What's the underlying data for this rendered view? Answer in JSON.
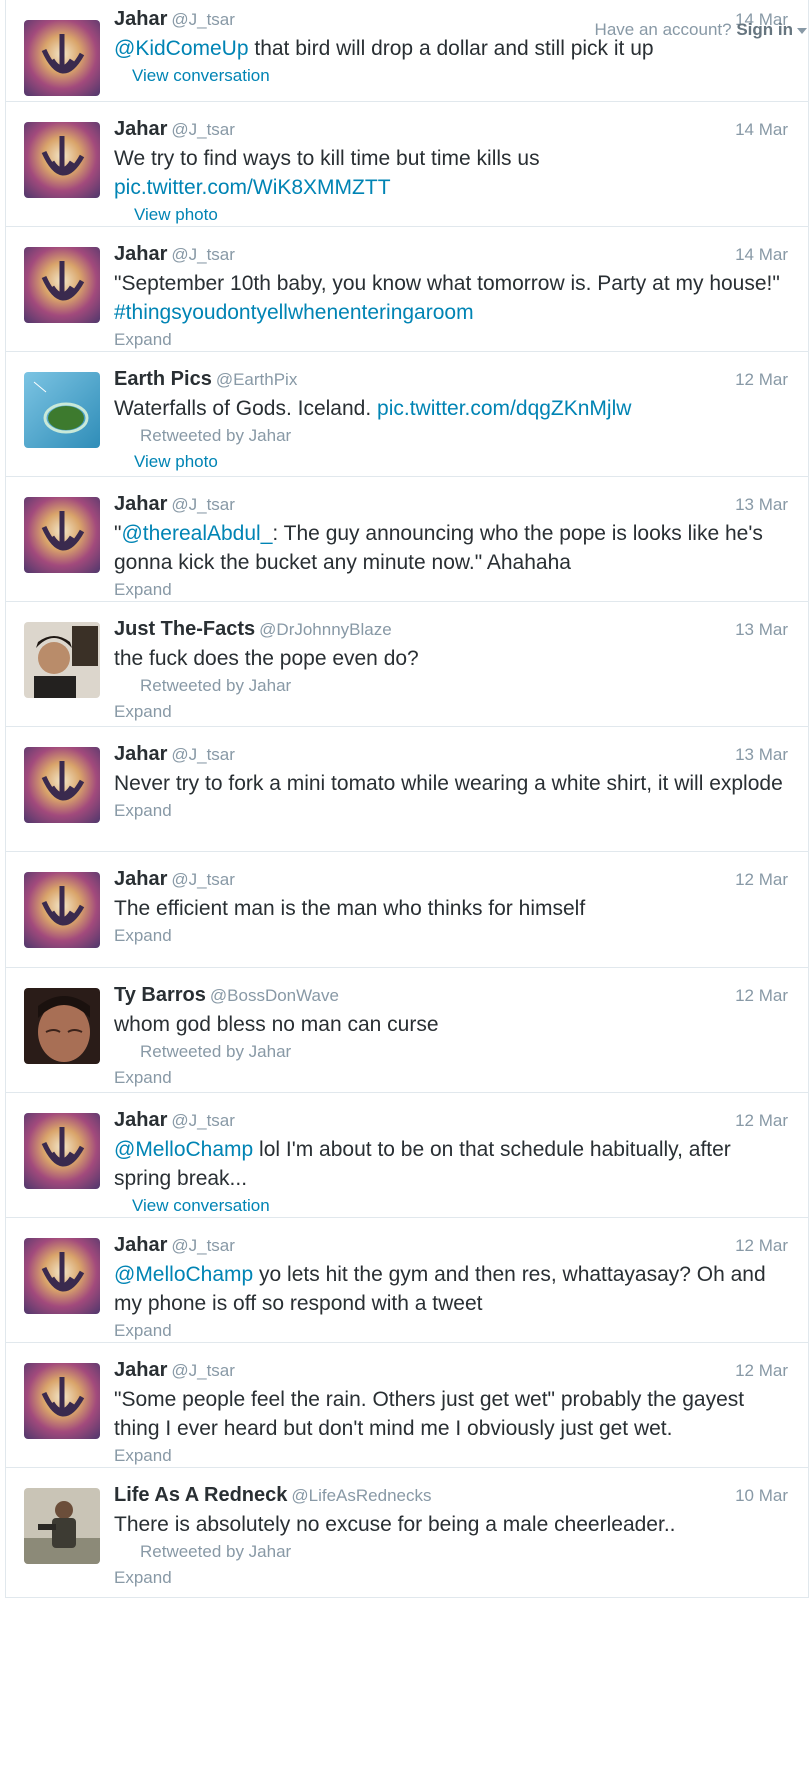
{
  "topbar": {
    "have_account": "Have an account?",
    "sign_in": "Sign in"
  },
  "tweets": [
    {
      "name": "Jahar",
      "handle": "@J_tsar",
      "time": "14 Mar",
      "mention": "@KidComeUp",
      "text": " that bird will drop a dollar and still pick it up",
      "action": "View conversation",
      "avatar": "galaxy"
    },
    {
      "name": "Jahar",
      "handle": "@J_tsar",
      "time": "14 Mar",
      "text": "We try to find ways to kill time but time kills us",
      "link": "pic.twitter.com/WiK8XMMZTT",
      "action": "View photo",
      "avatar": "galaxy"
    },
    {
      "name": "Jahar",
      "handle": "@J_tsar",
      "time": "14 Mar",
      "text": "\"September 10th baby, you know what tomorrow is. Party at my house!\" ",
      "hashtag": "#thingsyoudontyellwhenenteringaroom",
      "action": "Expand",
      "avatar": "galaxy"
    },
    {
      "name": "Earth Pics",
      "handle": "@EarthPix",
      "time": "12 Mar",
      "text": "Waterfalls of Gods. Iceland. ",
      "link": "pic.twitter.com/dqgZKnMjlw",
      "retweeted": "Retweeted by Jahar",
      "action": "View photo",
      "avatar": "island"
    },
    {
      "name": "Jahar",
      "handle": "@J_tsar",
      "time": "13 Mar",
      "quote_open": "\"",
      "mention": "@therealAbdul_",
      "text": ": The guy announcing who the pope is looks like he's gonna kick the bucket any minute now.\" Ahahaha",
      "action": "Expand",
      "avatar": "galaxy"
    },
    {
      "name": "Just The-Facts",
      "handle": "@DrJohnnyBlaze",
      "time": "13 Mar",
      "text": "the fuck does the pope even do?",
      "retweeted": "Retweeted by Jahar",
      "action": "Expand",
      "avatar": "person"
    },
    {
      "name": "Jahar",
      "handle": "@J_tsar",
      "time": "13 Mar",
      "text": "Never try to fork a mini tomato while wearing a white shirt, it will explode",
      "action": "Expand",
      "avatar": "galaxy"
    },
    {
      "name": "Jahar",
      "handle": "@J_tsar",
      "time": "12 Mar",
      "text": "The efficient man is the man who thinks for himself",
      "action": "Expand",
      "avatar": "galaxy"
    },
    {
      "name": "Ty Barros",
      "handle": "@BossDonWave",
      "time": "12 Mar",
      "text": "whom god bless no man can curse",
      "retweeted": "Retweeted by Jahar",
      "action": "Expand",
      "avatar": "face"
    },
    {
      "name": "Jahar",
      "handle": "@J_tsar",
      "time": "12 Mar",
      "mention": "@MelloChamp",
      "text": " lol I'm about to be on that schedule habitually, after spring break...",
      "action": "View conversation",
      "avatar": "galaxy"
    },
    {
      "name": "Jahar",
      "handle": "@J_tsar",
      "time": "12 Mar",
      "mention": "@MelloChamp",
      "text": " yo lets hit the gym and then res, whattayasay? Oh and my phone is off so respond with a tweet",
      "action": "Expand",
      "avatar": "galaxy"
    },
    {
      "name": "Jahar",
      "handle": "@J_tsar",
      "time": "12 Mar",
      "text": "\"Some people feel the rain. Others just get wet\" probably the gayest thing I ever heard but don't mind me I obviously just get wet.",
      "action": "Expand",
      "avatar": "galaxy"
    },
    {
      "name": "Life As A Redneck",
      "handle": "@LifeAsRednecks",
      "time": "10 Mar",
      "text": "There is absolutely no excuse for being a male cheerleader..",
      "retweeted": "Retweeted by Jahar",
      "action": "Expand",
      "avatar": "soldier"
    }
  ]
}
